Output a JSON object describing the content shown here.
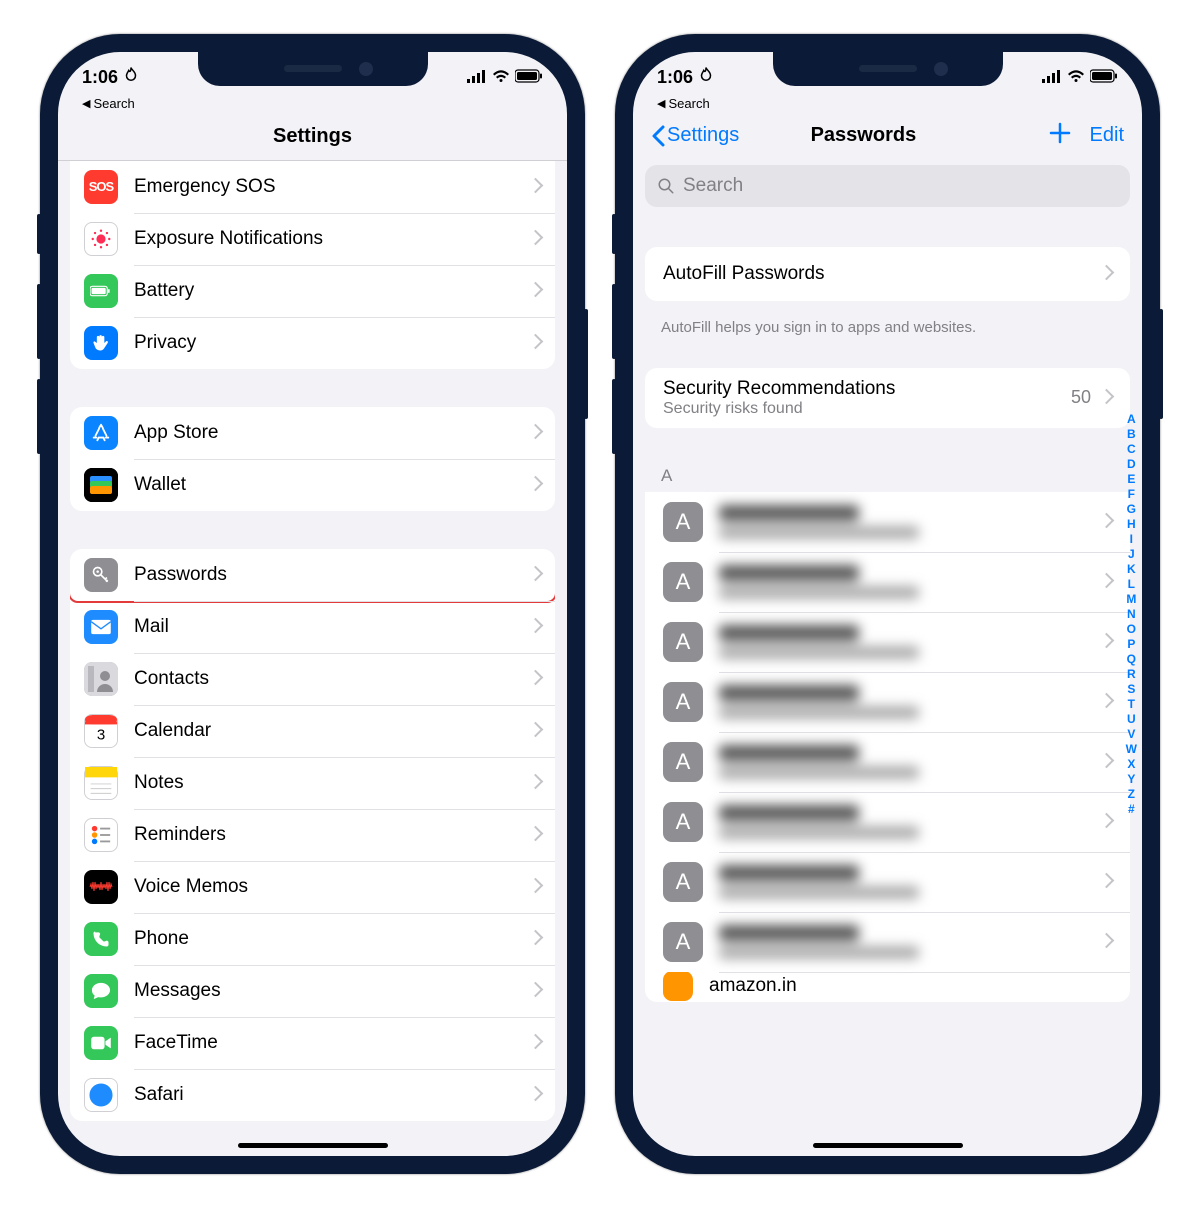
{
  "status": {
    "time": "1:06",
    "back_label": "Search"
  },
  "left": {
    "title": "Settings",
    "groups": [
      {
        "rows": [
          {
            "label": "Emergency SOS",
            "icon_bg": "#ff3b30",
            "icon": "sos"
          },
          {
            "label": "Exposure Notifications",
            "icon_bg": "#ffffff",
            "icon": "exposure",
            "icon_border": "#d0d0d4"
          },
          {
            "label": "Battery",
            "icon_bg": "#34c759",
            "icon": "battery"
          },
          {
            "label": "Privacy",
            "icon_bg": "#007aff",
            "icon": "hand"
          }
        ]
      },
      {
        "rows": [
          {
            "label": "App Store",
            "icon_bg": "#0a84ff",
            "icon": "appstore"
          },
          {
            "label": "Wallet",
            "icon_bg": "#000000",
            "icon": "wallet"
          }
        ]
      },
      {
        "rows": [
          {
            "label": "Passwords",
            "icon_bg": "#8e8e93",
            "icon": "key",
            "highlight": true
          },
          {
            "label": "Mail",
            "icon_bg": "#1e8cff",
            "icon": "mail"
          },
          {
            "label": "Contacts",
            "icon_bg": "#a7a7ad",
            "icon": "contacts"
          },
          {
            "label": "Calendar",
            "icon_bg": "#ffffff",
            "icon": "calendar",
            "icon_border": "#d0d0d4"
          },
          {
            "label": "Notes",
            "icon_bg": "#ffffff",
            "icon": "notes",
            "icon_border": "#d0d0d4"
          },
          {
            "label": "Reminders",
            "icon_bg": "#ffffff",
            "icon": "reminders",
            "icon_border": "#d0d0d4"
          },
          {
            "label": "Voice Memos",
            "icon_bg": "#000000",
            "icon": "voice"
          },
          {
            "label": "Phone",
            "icon_bg": "#34c759",
            "icon": "phone"
          },
          {
            "label": "Messages",
            "icon_bg": "#34c759",
            "icon": "messages"
          },
          {
            "label": "FaceTime",
            "icon_bg": "#34c759",
            "icon": "facetime"
          },
          {
            "label": "Safari",
            "icon_bg": "#ffffff",
            "icon": "safari",
            "icon_border": "#d0d0d4"
          }
        ]
      }
    ]
  },
  "right": {
    "back_label": "Settings",
    "title": "Passwords",
    "edit_label": "Edit",
    "search_placeholder": "Search",
    "autofill": {
      "label": "AutoFill Passwords",
      "footer": "AutoFill helps you sign in to apps and websites."
    },
    "security": {
      "title": "Security Recommendations",
      "subtitle": "Security risks found",
      "count": "50"
    },
    "section_letter": "A",
    "entries": [
      {
        "letter": "A"
      },
      {
        "letter": "A"
      },
      {
        "letter": "A"
      },
      {
        "letter": "A"
      },
      {
        "letter": "A"
      },
      {
        "letter": "A"
      },
      {
        "letter": "A"
      },
      {
        "letter": "A"
      }
    ],
    "last_visible": "amazon.in",
    "index": [
      "A",
      "B",
      "C",
      "D",
      "E",
      "F",
      "G",
      "H",
      "I",
      "J",
      "K",
      "L",
      "M",
      "N",
      "O",
      "P",
      "Q",
      "R",
      "S",
      "T",
      "U",
      "V",
      "W",
      "X",
      "Y",
      "Z",
      "#"
    ]
  }
}
